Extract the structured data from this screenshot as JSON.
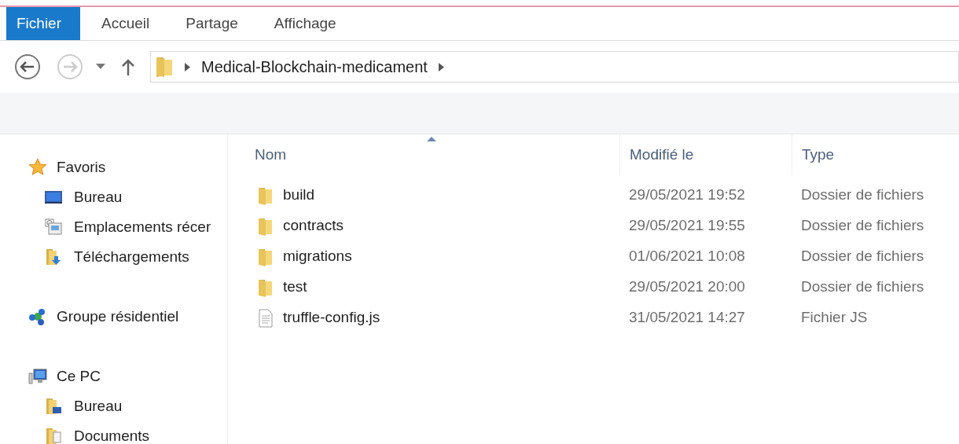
{
  "ribbon_tabs": [
    {
      "label": "Fichier",
      "selected": true
    },
    {
      "label": "Accueil",
      "selected": false
    },
    {
      "label": "Partage",
      "selected": false
    },
    {
      "label": "Affichage",
      "selected": false
    }
  ],
  "address_bar": {
    "path": [
      "Medical-Blockchain-medicament"
    ]
  },
  "sidebar": {
    "groups": [
      {
        "label": "Favoris",
        "kind": "star",
        "children": [
          {
            "label": "Bureau",
            "kind": "desktop"
          },
          {
            "label": "Emplacements récer",
            "kind": "recent"
          },
          {
            "label": "Téléchargements",
            "kind": "downloads"
          }
        ]
      },
      {
        "label": "Groupe résidentiel",
        "kind": "homegroup"
      },
      {
        "label": "Ce PC",
        "kind": "pc",
        "children": [
          {
            "label": "Bureau",
            "kind": "desktop-folder"
          },
          {
            "label": "Documents",
            "kind": "documents-folder"
          }
        ]
      }
    ]
  },
  "table": {
    "columns": [
      "Nom",
      "Modifié le",
      "Type"
    ],
    "rows": [
      {
        "kind": "folder",
        "name": "build",
        "modified": "29/05/2021 19:52",
        "type": "Dossier de fichiers"
      },
      {
        "kind": "folder",
        "name": "contracts",
        "modified": "29/05/2021 19:55",
        "type": "Dossier de fichiers"
      },
      {
        "kind": "folder",
        "name": "migrations",
        "modified": "01/06/2021 10:08",
        "type": "Dossier de fichiers"
      },
      {
        "kind": "folder",
        "name": "test",
        "modified": "29/05/2021 20:00",
        "type": "Dossier de fichiers"
      },
      {
        "kind": "file",
        "name": "truffle-config.js",
        "modified": "31/05/2021 14:27",
        "type": "Fichier JS"
      }
    ]
  }
}
